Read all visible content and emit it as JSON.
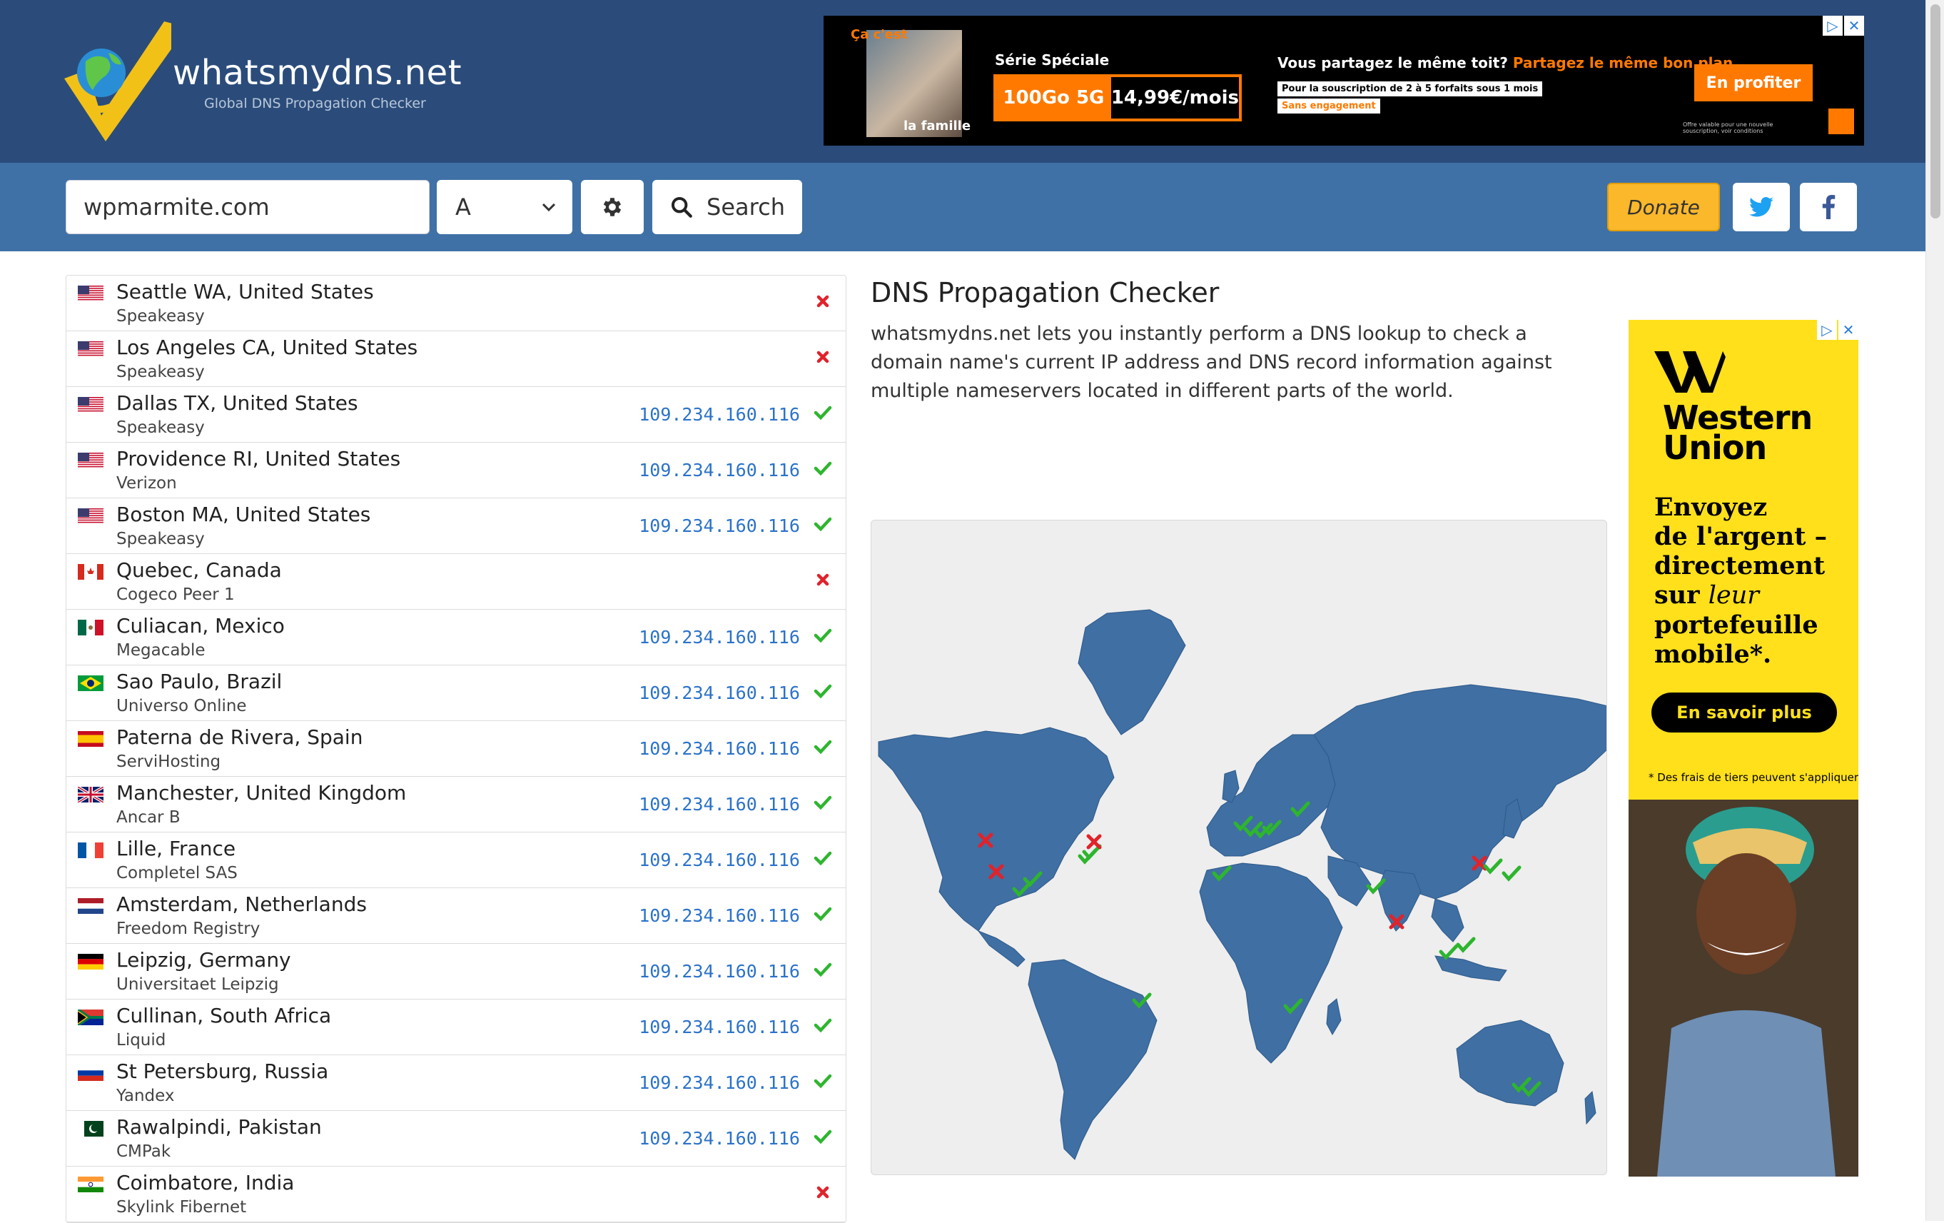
{
  "header": {
    "logo_title": "whatsmydns.net",
    "logo_subtitle": "Global DNS Propagation Checker"
  },
  "ad_top": {
    "photo_caption_top": "Ça c'est",
    "photo_caption_bottom": "la famille",
    "series": "Série Spéciale",
    "offer_data": "100Go 5G",
    "offer_price": "14,99€/mois",
    "headline": "Vous partagez le même toit?",
    "headline_accent": "Partagez le même bon plan.",
    "subscription_note": "Pour la souscription de 2 à 5 forfaits sous 1 mois",
    "no_commitment": "Sans engagement",
    "cta": "En profiter",
    "fine_print": "Offre valable pour une nouvelle souscription, voir conditions"
  },
  "search": {
    "domain_value": "wpmarmite.com",
    "record_type": "A",
    "search_label": "Search",
    "donate_label": "Donate"
  },
  "results": [
    {
      "location": "Seattle WA, United States",
      "provider": "Speakeasy",
      "ip": "",
      "status": "fail",
      "flag": "us"
    },
    {
      "location": "Los Angeles CA, United States",
      "provider": "Speakeasy",
      "ip": "",
      "status": "fail",
      "flag": "us"
    },
    {
      "location": "Dallas TX, United States",
      "provider": "Speakeasy",
      "ip": "109.234.160.116",
      "status": "ok",
      "flag": "us"
    },
    {
      "location": "Providence RI, United States",
      "provider": "Verizon",
      "ip": "109.234.160.116",
      "status": "ok",
      "flag": "us"
    },
    {
      "location": "Boston MA, United States",
      "provider": "Speakeasy",
      "ip": "109.234.160.116",
      "status": "ok",
      "flag": "us"
    },
    {
      "location": "Quebec, Canada",
      "provider": "Cogeco Peer 1",
      "ip": "",
      "status": "fail",
      "flag": "ca"
    },
    {
      "location": "Culiacan, Mexico",
      "provider": "Megacable",
      "ip": "109.234.160.116",
      "status": "ok",
      "flag": "mx"
    },
    {
      "location": "Sao Paulo, Brazil",
      "provider": "Universo Online",
      "ip": "109.234.160.116",
      "status": "ok",
      "flag": "br"
    },
    {
      "location": "Paterna de Rivera, Spain",
      "provider": "ServiHosting",
      "ip": "109.234.160.116",
      "status": "ok",
      "flag": "es"
    },
    {
      "location": "Manchester, United Kingdom",
      "provider": "Ancar B",
      "ip": "109.234.160.116",
      "status": "ok",
      "flag": "gb"
    },
    {
      "location": "Lille, France",
      "provider": "Completel SAS",
      "ip": "109.234.160.116",
      "status": "ok",
      "flag": "fr"
    },
    {
      "location": "Amsterdam, Netherlands",
      "provider": "Freedom Registry",
      "ip": "109.234.160.116",
      "status": "ok",
      "flag": "nl"
    },
    {
      "location": "Leipzig, Germany",
      "provider": "Universitaet Leipzig",
      "ip": "109.234.160.116",
      "status": "ok",
      "flag": "de"
    },
    {
      "location": "Cullinan, South Africa",
      "provider": "Liquid",
      "ip": "109.234.160.116",
      "status": "ok",
      "flag": "za"
    },
    {
      "location": "St Petersburg, Russia",
      "provider": "Yandex",
      "ip": "109.234.160.116",
      "status": "ok",
      "flag": "ru"
    },
    {
      "location": "Rawalpindi, Pakistan",
      "provider": "CMPak",
      "ip": "109.234.160.116",
      "status": "ok",
      "flag": "pk"
    },
    {
      "location": "Coimbatore, India",
      "provider": "Skylink Fibernet",
      "ip": "",
      "status": "fail",
      "flag": "in"
    }
  ],
  "content": {
    "title": "DNS Propagation Checker",
    "description": "whatsmydns.net lets you instantly perform a DNS lookup to check a domain name's current IP address and DNS record information against multiple nameservers located in different parts of the world."
  },
  "ad_side": {
    "brand_line1": "Western",
    "brand_line2": "Union",
    "msg_line1": "Envoyez",
    "msg_line2": "de l'argent –",
    "msg_line3": "directement",
    "msg_line4a": "sur ",
    "msg_line4b": "leur",
    "msg_line5": "portefeuille",
    "msg_line6": "mobile*.",
    "cta": "En savoir plus",
    "note": "* Des frais de tiers peuvent s'appliquer."
  },
  "colors": {
    "header_bg": "#2b4c7a",
    "searchbar_bg": "#3f71a6",
    "ok": "#2eb52e",
    "fail": "#e0232b",
    "ip": "#2b72c9",
    "map_land": "#3f6fa3",
    "donate": "#fbb82a"
  }
}
